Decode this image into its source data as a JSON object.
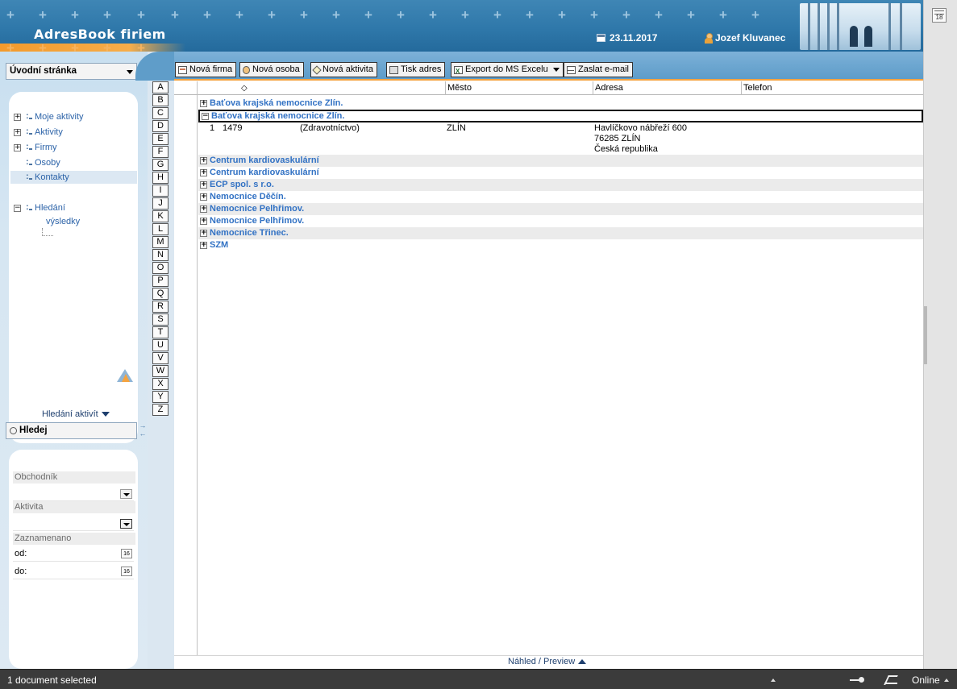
{
  "header": {
    "app_title": "AdresBook firiem",
    "date": "23.11.2017",
    "user": "Jozef Kluvanec"
  },
  "navigation": {
    "view_select": "Úvodní stránka",
    "tree": [
      {
        "label": "Moje aktivity",
        "expandable": true
      },
      {
        "label": "Aktivity",
        "expandable": true
      },
      {
        "label": "Firmy",
        "expandable": true
      },
      {
        "label": "Osoby",
        "expandable": false
      },
      {
        "label": "Kontakty",
        "expandable": false,
        "selected": true
      },
      {
        "label": "Hledání",
        "expandable": true,
        "expanded": true
      },
      {
        "label": "výsledky",
        "expandable": false
      }
    ]
  },
  "search": {
    "section_label": "Hledání aktivít",
    "select_label": "Hledej",
    "fields": {
      "merchant_label": "Obchodník",
      "activity_label": "Aktivita",
      "recorded_label": "Zaznamenano",
      "from_label": "od:",
      "to_label": "do:",
      "calendar_day": "16"
    }
  },
  "letters": [
    "A",
    "B",
    "C",
    "D",
    "E",
    "F",
    "G",
    "H",
    "I",
    "J",
    "K",
    "L",
    "M",
    "N",
    "O",
    "P",
    "Q",
    "R",
    "S",
    "T",
    "U",
    "V",
    "W",
    "X",
    "Y",
    "Z"
  ],
  "toolbar": {
    "new_company": "Nová firma",
    "new_person": "Nová osoba",
    "new_activity": "Nová aktivita",
    "print_addresses": "Tisk adres",
    "export_excel": "Export do MS Excelu",
    "send_email": "Zaslat e-mail"
  },
  "grid": {
    "columns": {
      "sort_glyph": "◇",
      "city": "Město",
      "address": "Adresa",
      "phone": "Telefon"
    },
    "groups": [
      {
        "label": "Baťova krajská nemocnice Zlín.",
        "expanded": false
      },
      {
        "label": "Baťova krajská nemocnice Zlín.",
        "expanded": true
      },
      {
        "label": "Centrum kardiovaskulární",
        "expanded": false
      },
      {
        "label": "Centrum kardiovaskulární",
        "expanded": false
      },
      {
        "label": "ECP spol. s r.o.",
        "expanded": false
      },
      {
        "label": "Nemocnice Děčín.",
        "expanded": false
      },
      {
        "label": "Nemocnice Pelhřimov.",
        "expanded": false
      },
      {
        "label": "Nemocnice Pelhřimov.",
        "expanded": false
      },
      {
        "label": "Nemocnice Třinec.",
        "expanded": false
      },
      {
        "label": "SZM",
        "expanded": false
      }
    ],
    "detail": {
      "index": "1",
      "number": "1479",
      "category": "(Zdravotníctvo)",
      "city": "ZLÍN",
      "address_line1": "Havlíčkovo nábřeží 600",
      "address_line2": "76285 ZLÍN",
      "address_line3": "Česká republika"
    }
  },
  "preview": {
    "label": "Náhled / Preview"
  },
  "rail": {
    "calendar_day": "18"
  },
  "status": {
    "text": "1 document selected",
    "online": "Online"
  }
}
